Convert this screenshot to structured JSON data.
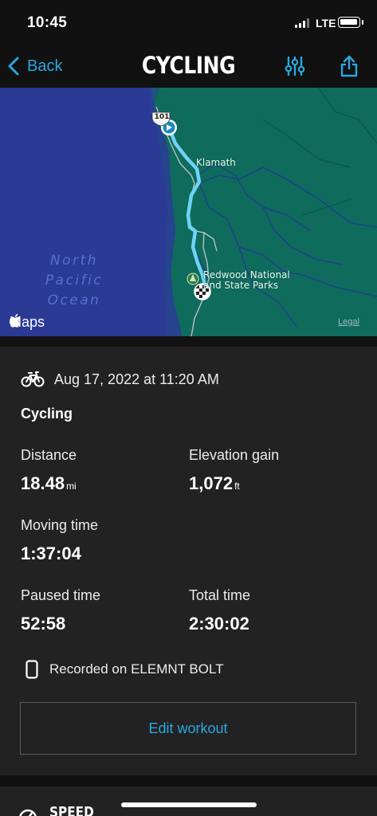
{
  "status_bar": {
    "time": "10:45",
    "network": "LTE",
    "signal_bars": 3,
    "battery_level": 0.9
  },
  "nav": {
    "back_label": "Back",
    "title": "CYCLING",
    "icons": [
      "chevron-left-icon",
      "sliders-icon",
      "share-icon"
    ]
  },
  "map": {
    "ocean_lines": [
      "North",
      "Pacific",
      "Ocean"
    ],
    "place_label": "Klamath",
    "park_line1": "Redwood National",
    "park_line2": "and State Parks",
    "highway_shield": "101",
    "attribution": "Maps",
    "legal": "Legal"
  },
  "workout": {
    "date": "Aug 17, 2022 at 11:20 AM",
    "activity": "Cycling",
    "stats": [
      {
        "label": "Distance",
        "value": "18.48",
        "unit": "mi"
      },
      {
        "label": "Elevation gain",
        "value": "1,072",
        "unit": "ft"
      },
      {
        "label": "Moving time",
        "value": "1:37:04",
        "unit": ""
      },
      {
        "label": "Paused time",
        "value": "52:58",
        "unit": ""
      },
      {
        "label": "Total time",
        "value": "2:30:02",
        "unit": ""
      }
    ],
    "recorded_on": "Recorded on ELEMNT BOLT",
    "edit_button": "Edit workout"
  },
  "next_section": {
    "title": "SPEED"
  },
  "colors": {
    "accent": "#28a8e0",
    "background": "#111111",
    "card": "#222222",
    "ocean": "#2a3a95",
    "land": "#0f6b5c",
    "route": "#6fd3f5"
  }
}
